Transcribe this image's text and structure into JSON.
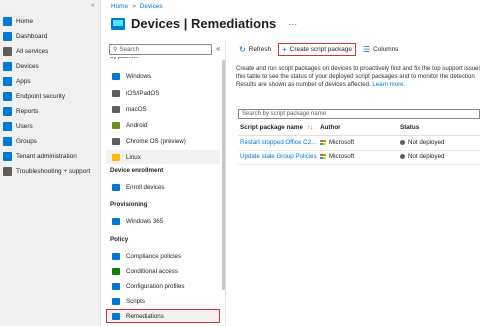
{
  "global_nav": {
    "collapse_label": "«",
    "items": [
      {
        "label": "Home",
        "icon": "home-icon",
        "color": "#0078d4"
      },
      {
        "label": "Dashboard",
        "icon": "dashboard-icon",
        "color": "#0078d4"
      },
      {
        "label": "All services",
        "icon": "all-services-icon",
        "color": "#605e5c"
      },
      {
        "label": "Devices",
        "icon": "devices-icon",
        "color": "#0078d4"
      },
      {
        "label": "Apps",
        "icon": "apps-icon",
        "color": "#0078d4"
      },
      {
        "label": "Endpoint security",
        "icon": "endpoint-security-icon",
        "color": "#0078d4"
      },
      {
        "label": "Reports",
        "icon": "reports-icon",
        "color": "#0078d4"
      },
      {
        "label": "Users",
        "icon": "users-icon",
        "color": "#0078d4"
      },
      {
        "label": "Groups",
        "icon": "groups-icon",
        "color": "#0078d4"
      },
      {
        "label": "Tenant administration",
        "icon": "tenant-admin-icon",
        "color": "#0078d4"
      },
      {
        "label": "Troubleshooting + support",
        "icon": "troubleshooting-icon",
        "color": "#605e5c"
      }
    ]
  },
  "breadcrumb": {
    "home": "Home",
    "separator": ">",
    "devices": "Devices"
  },
  "page": {
    "title": "Devices | Remediations",
    "more": "···"
  },
  "subnav": {
    "search_placeholder": "Search",
    "collapse": "«",
    "partial_header": "By platform",
    "platform_items": [
      {
        "label": "Windows",
        "icon": "windows-icon",
        "color": "#0078d4"
      },
      {
        "label": "iOS/iPadOS",
        "icon": "ios-icon",
        "color": "#605e5c"
      },
      {
        "label": "macOS",
        "icon": "macos-icon",
        "color": "#605e5c"
      },
      {
        "label": "Android",
        "icon": "android-icon",
        "color": "#6b8e23"
      },
      {
        "label": "Chrome OS (preview)",
        "icon": "chromeos-icon",
        "color": "#605e5c"
      },
      {
        "label": "Linux",
        "icon": "linux-icon",
        "color": "#ffb900"
      }
    ],
    "section_enrollment": "Device enrollment",
    "enrollment_items": [
      {
        "label": "Enroll devices",
        "icon": "enroll-devices-icon",
        "color": "#0078d4"
      }
    ],
    "section_provisioning": "Provisioning",
    "provisioning_items": [
      {
        "label": "Windows 365",
        "icon": "windows365-icon",
        "color": "#0078d4"
      }
    ],
    "section_policy": "Policy",
    "policy_items": [
      {
        "label": "Compliance policies",
        "icon": "compliance-icon",
        "color": "#0078d4"
      },
      {
        "label": "Conditional access",
        "icon": "conditional-access-icon",
        "color": "#107c10"
      },
      {
        "label": "Configuration profiles",
        "icon": "configuration-icon",
        "color": "#0078d4"
      },
      {
        "label": "Scripts",
        "icon": "scripts-icon",
        "color": "#0078d4"
      },
      {
        "label": "Remediations",
        "icon": "remediations-icon",
        "color": "#0078d4"
      }
    ]
  },
  "toolbar": {
    "refresh": "Refresh",
    "create": "Create script package",
    "columns": "Columns"
  },
  "description": {
    "line1": "Create and run script packages on devices to proactively find and fix the top support issues",
    "line2": "this table to see the status of your deployed script packages and to monitor the detection",
    "line3": "Results are shown as number of devices affected.",
    "learn_more": "Learn more."
  },
  "table": {
    "search_placeholder": "Search by script package name",
    "headers": {
      "name": "Script package name",
      "sort": "↑↓",
      "author": "Author",
      "status": "Status"
    },
    "rows": [
      {
        "name": "Restart stopped Office C2...",
        "author": "Microsoft",
        "status": "Not deployed"
      },
      {
        "name": "Update stale Group Policies",
        "author": "Microsoft",
        "status": "Not deployed"
      }
    ]
  },
  "colors": {
    "accent": "#0078d4",
    "highlight_box": "#d13438"
  }
}
